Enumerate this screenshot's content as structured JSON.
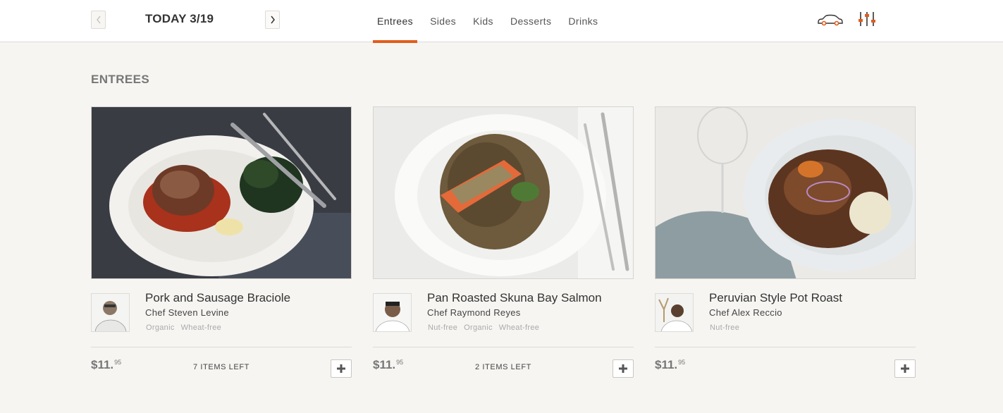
{
  "header": {
    "date_label": "TODAY 3/19",
    "prev_icon": "chevron-left-icon",
    "next_icon": "chevron-right-icon",
    "tabs": [
      {
        "label": "Entrees",
        "active": true
      },
      {
        "label": "Sides",
        "active": false
      },
      {
        "label": "Kids",
        "active": false
      },
      {
        "label": "Desserts",
        "active": false
      },
      {
        "label": "Drinks",
        "active": false
      }
    ],
    "utility_icons": [
      "car-icon",
      "filter-sliders-icon"
    ]
  },
  "section": {
    "title": "ENTREES"
  },
  "products": [
    {
      "dish": "Pork and Sausage Braciole",
      "chef": "Chef Steven Levine",
      "tags": [
        "Organic",
        "Wheat-free"
      ],
      "price_main": "$11.",
      "price_cents": "95",
      "items_left": "7 ITEMS LEFT"
    },
    {
      "dish": "Pan Roasted Skuna Bay Salmon",
      "chef": "Chef Raymond Reyes",
      "tags": [
        "Nut-free",
        "Organic",
        "Wheat-free"
      ],
      "price_main": "$11.",
      "price_cents": "95",
      "items_left": "2 ITEMS LEFT"
    },
    {
      "dish": "Peruvian Style Pot Roast",
      "chef": "Chef Alex Reccio",
      "tags": [
        "Nut-free"
      ],
      "price_main": "$11.",
      "price_cents": "95",
      "items_left": ""
    }
  ],
  "colors": {
    "accent": "#e25c1b",
    "background": "#f6f5f2",
    "header": "#ffffff"
  }
}
